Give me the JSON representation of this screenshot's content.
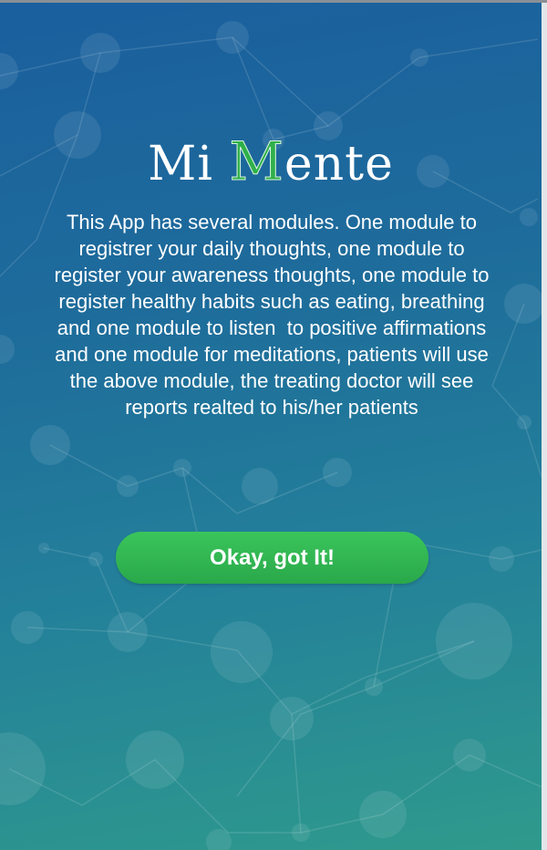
{
  "app": {
    "title_part1": "Mi ",
    "title_m": "M",
    "title_part2": "ente"
  },
  "intro": {
    "description": "This App has several modules. One module to registrer your daily thoughts, one module to register your awareness thoughts, one module to register healthy habits such as eating, breathing and one module to listen  to positive affirmations and one module for meditations, patients will use the above module, the treating doctor will see reports realted to his/her patients"
  },
  "actions": {
    "ok_label": "Okay, got It!"
  },
  "colors": {
    "background_top": "#1a5f9e",
    "background_bottom": "#2f9a8c",
    "accent_green": "#2fb04a",
    "button_green": "#32b654"
  }
}
